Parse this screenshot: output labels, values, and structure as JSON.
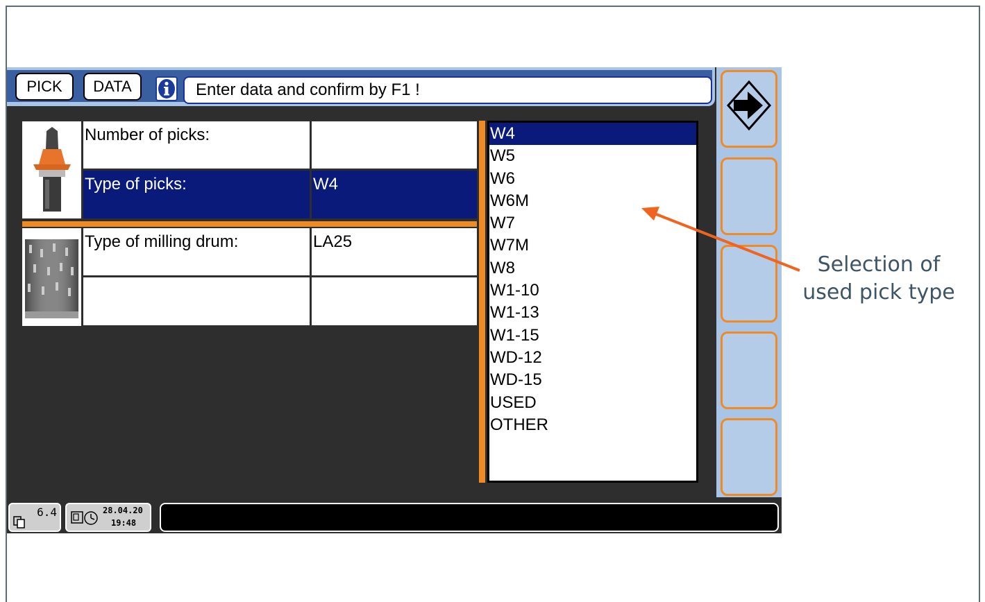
{
  "toolbar": {
    "pick_label": "PICK",
    "data_label": "DATA",
    "info_icon": "info-icon",
    "message": "Enter data and confirm by F1 !"
  },
  "form": {
    "rows": [
      {
        "label": "Number of picks:",
        "value": ""
      },
      {
        "label": "Type of picks:",
        "value": "W4",
        "selected": true
      },
      {
        "label": "Type of milling drum:",
        "value": "LA25"
      },
      {
        "label": "",
        "value": ""
      }
    ]
  },
  "pick_list": {
    "items": [
      "W4",
      "W5",
      "W6",
      "W6M",
      "W7",
      "W7M",
      "W8",
      "W1-10",
      "W1-13",
      "W1-15",
      "WD-12",
      "WD-15",
      "USED",
      "OTHER"
    ],
    "selected": "W4"
  },
  "fkeys": {
    "f1_icon": "confirm-arrow-icon"
  },
  "status": {
    "version": "6.4",
    "date": "28.04.20",
    "time": "19:48"
  },
  "annotation": {
    "line1": "Selection of",
    "line2": "used pick type"
  },
  "colors": {
    "screen_bg": "#2e2e2e",
    "selection": "#0a1a7a",
    "accent_orange": "#f08a25",
    "fkey_panel": "#a8c4e6",
    "annotation_arrow": "#f0641e"
  }
}
